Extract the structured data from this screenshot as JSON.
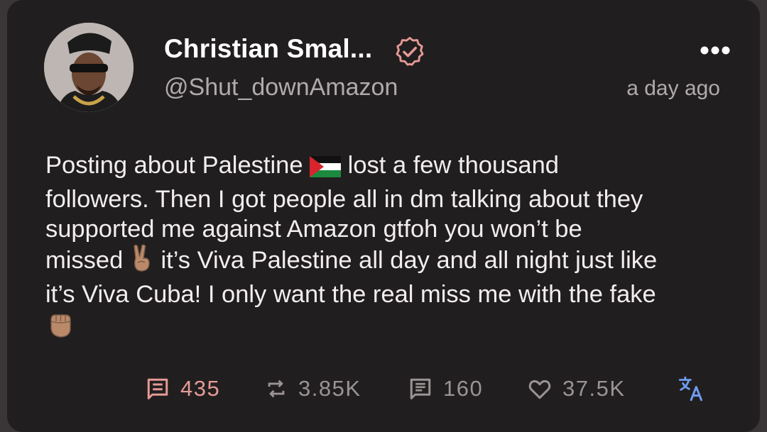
{
  "post": {
    "author_name": "Christian Smal...",
    "handle": "@Shut_downAmazon",
    "timestamp": "a day ago",
    "verified": true,
    "lines": [
      [
        "Posting about Palestine ",
        "flag-icon",
        " lost a few thousand"
      ],
      [
        "followers. Then I got people all in dm talking about they"
      ],
      [
        "supported me against Amazon gtfoh you won’t be"
      ],
      [
        "missed ",
        "victory-hand-icon",
        " it’s Viva Palestine all day and all night just like"
      ],
      [
        "it’s Viva Cuba! I only want the real miss me with the fake"
      ],
      [
        "raised-fist-icon"
      ]
    ]
  },
  "stats": {
    "replies": "435",
    "reposts": "3.85K",
    "quotes": "160",
    "likes": "37.5K"
  },
  "icons": {
    "verified": "verified-badge-icon",
    "more": "more-options-icon",
    "reply": "reply-icon",
    "repost": "repost-icon",
    "quote": "quote-icon",
    "like": "heart-icon",
    "translate": "translate-icon"
  },
  "colors": {
    "card_background": "#211e1f",
    "text_primary": "#f2eeef",
    "text_secondary": "#b0aaab",
    "accent_reply": "#e59a95",
    "verified_badge": "#e59a95",
    "translate_icon": "#6e9cf0"
  }
}
